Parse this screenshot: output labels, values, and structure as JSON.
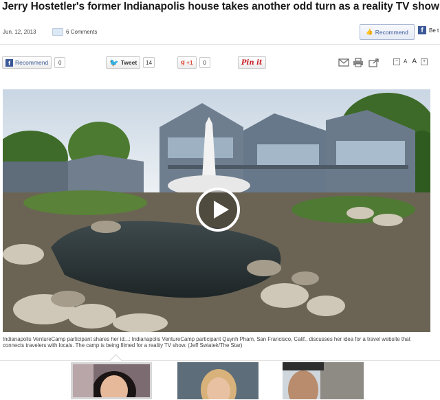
{
  "article": {
    "headline": "Jerry Hostetler's former Indianapolis house takes another odd turn as a reality TV show set",
    "date": "Jun. 12, 2013",
    "comments": "6 Comments"
  },
  "top_actions": {
    "recommend_label": "Recommend",
    "facebook_glyph": "f",
    "facebook_text": "Be t"
  },
  "social": {
    "facebook": {
      "glyph": "f",
      "label": "Recommend",
      "count": "0"
    },
    "twitter": {
      "glyph": "🐦",
      "label": "Tweet",
      "count": "14"
    },
    "gplus": {
      "label": "+1",
      "count": "0"
    },
    "pinterest": {
      "label": "Pin it"
    }
  },
  "tools": {
    "icons": [
      "email-icon",
      "print-icon",
      "share-icon"
    ],
    "font_minus": "−",
    "font_small": "A",
    "font_large": "A",
    "font_plus": "+"
  },
  "media": {
    "caption": "Indianapolis VentureCamp participant shares her id...: Indianapolis VentureCamp participant Quynh Pham, San Francisco, Calif., discusses her idea for a travel website that connects travelers with locals. The camp is being filmed for a reality TV show. (Jeff Swiatek/The Star)"
  },
  "colors": {
    "facebook": "#3b5998",
    "twitter": "#33a8dc",
    "gplus": "#dd4b39",
    "pinterest": "#cb2027"
  }
}
